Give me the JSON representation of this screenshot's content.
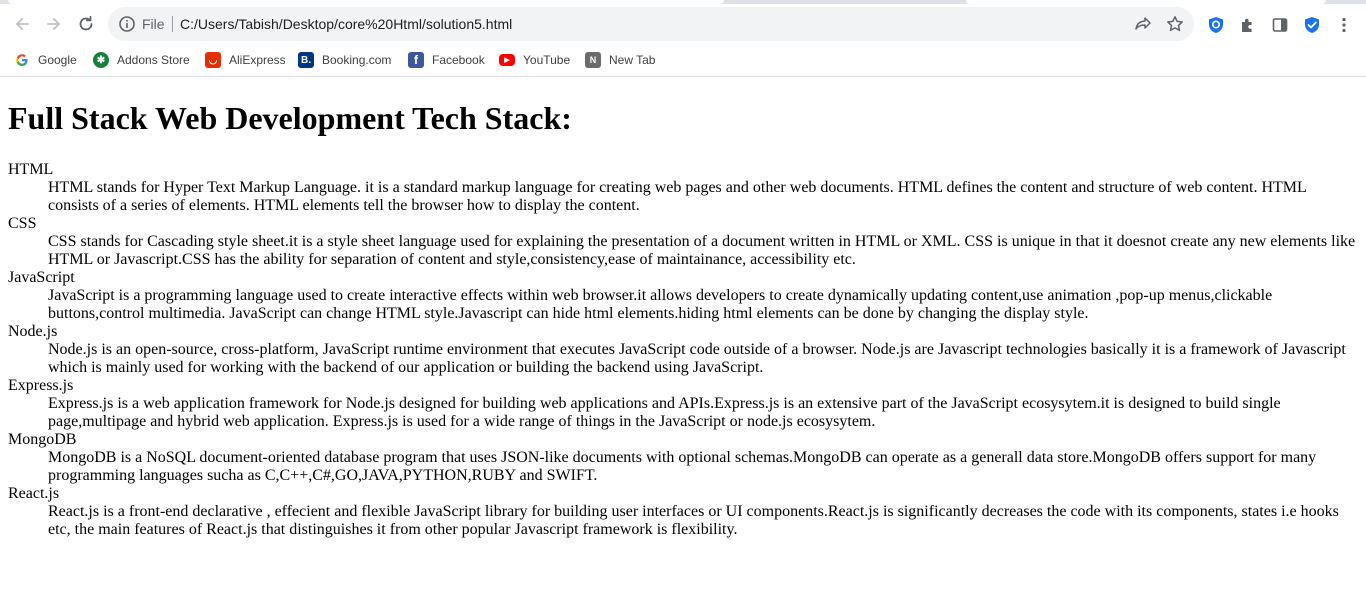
{
  "browser": {
    "omnibox": {
      "scheme_label": "File",
      "url": "C:/Users/Tabish/Desktop/core%20Html/solution5.html"
    },
    "bookmarks": [
      {
        "label": "Google",
        "icon": "google-icon"
      },
      {
        "label": "Addons Store",
        "icon": "addons-store-icon"
      },
      {
        "label": "AliExpress",
        "icon": "aliexpress-icon"
      },
      {
        "label": "Booking.com",
        "icon": "booking-icon"
      },
      {
        "label": "Facebook",
        "icon": "facebook-icon"
      },
      {
        "label": "YouTube",
        "icon": "youtube-icon"
      },
      {
        "label": "New Tab",
        "icon": "new-tab-icon"
      }
    ]
  },
  "page": {
    "title": "Full Stack Web Development Tech Stack:",
    "items": [
      {
        "term": "HTML",
        "description": "HTML stands for Hyper Text Markup Language. it is a standard markup language for creating web pages and other web documents. HTML defines the content and structure of web content. HTML consists of a series of elements. HTML elements tell the browser how to display the content."
      },
      {
        "term": "CSS",
        "description": "CSS stands for Cascading style sheet.it is a style sheet language used for explaining the presentation of a document written in HTML or XML. CSS is unique in that it doesnot create any new elements like HTML or Javascript.CSS has the ability for separation of content and style,consistency,ease of maintainance, accessibility etc."
      },
      {
        "term": "JavaScript",
        "description": "JavaScript is a programming language used to create interactive effects within web browser.it allows developers to create dynamically updating content,use animation ,pop-up menus,clickable buttons,control multimedia. JavaScript can change HTML style.Javascript can hide html elements.hiding html elements can be done by changing the display style."
      },
      {
        "term": "Node.js",
        "description": "Node.js is an open-source, cross-platform, JavaScript runtime environment that executes JavaScript code outside of a browser. Node.js are Javascript technologies basically it is a framework of Javascript which is mainly used for working with the backend of our application or building the backend using JavaScript."
      },
      {
        "term": "Express.js",
        "description": "Express.js is a web application framework for Node.js designed for building web applications and APIs.Express.js is an extensive part of the JavaScript ecosysytem.it is designed to build single page,multipage and hybrid web application. Express.js is used for a wide range of things in the JavaScript or node.js ecosysytem."
      },
      {
        "term": "MongoDB",
        "description": "MongoDB is a NoSQL document-oriented database program that uses JSON-like documents with optional schemas.MongoDB can operate as a generall data store.MongoDB offers support for many programming languages sucha as C,C++,C#,GO,JAVA,PYTHON,RUBY and SWIFT."
      },
      {
        "term": "React.js",
        "description": "React.js is a front-end declarative , effecient and flexible JavaScript library for building user interfaces or UI components.React.js is significantly decreases the code with its components, states i.e hooks etc, the main features of React.js that distinguishes it from other popular Javascript framework is flexibility."
      }
    ]
  }
}
